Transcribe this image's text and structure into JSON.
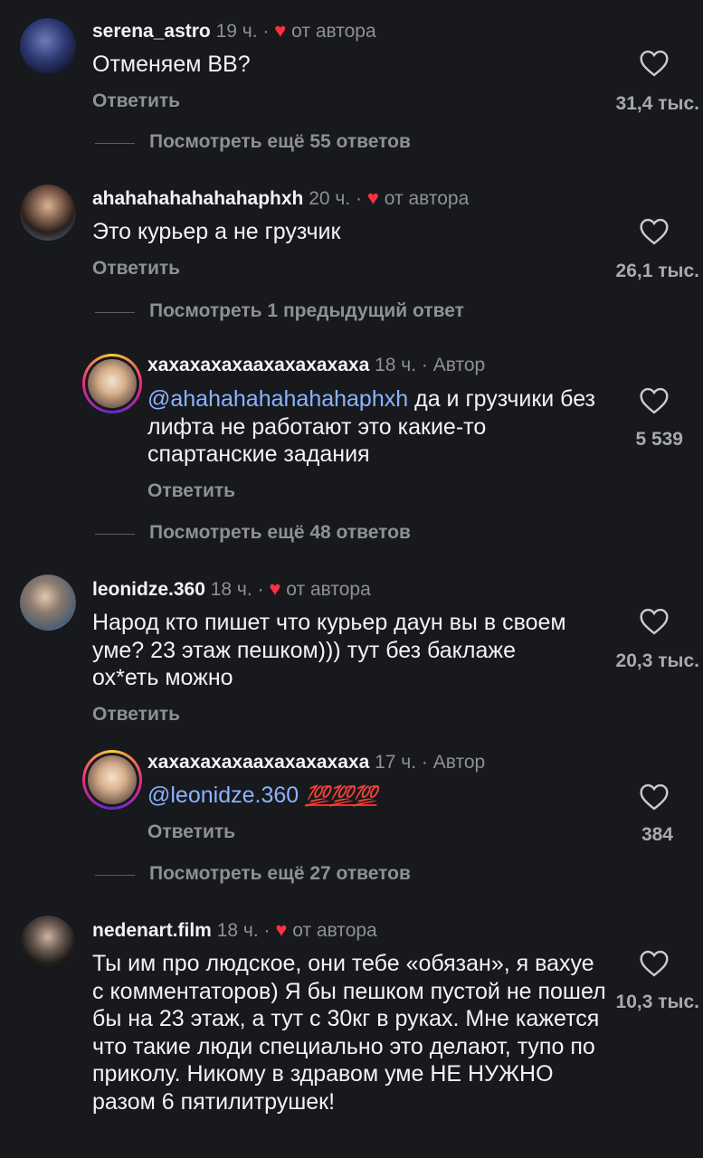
{
  "comments": [
    {
      "user": "serena_astro",
      "time": "19 ч.",
      "sep": "·",
      "badge": "от автора",
      "text": "Отменяем ВВ?",
      "reply": "Ответить",
      "likes": "31,4 тыс.",
      "more": "Посмотреть ещё 55 ответов"
    },
    {
      "user": "ahahahahahahahaphxh",
      "time": "20 ч.",
      "sep": "·",
      "badge": "от автора",
      "text": "Это курьер а не грузчик",
      "reply": "Ответить",
      "likes": "26,1 тыс.",
      "more": "Посмотреть 1 предыдущий ответ"
    },
    {
      "user": "хахахахахаахахахахаха",
      "time": "18 ч.",
      "sep": "·",
      "badge": "Автор",
      "mention": "@ahahahahahahahaphxh",
      "text": " да и грузчики без лифта не работают это какие-то спартанские задания",
      "reply": "Ответить",
      "likes": "5 539",
      "more": "Посмотреть ещё 48 ответов"
    },
    {
      "user": "leonidze.360",
      "time": "18 ч.",
      "sep": "·",
      "badge": "от автора",
      "text": "Народ кто пишет что курьер даун вы в своем уме? 23 этаж пешком))) тут без баклаже ох*еть можно",
      "reply": "Ответить",
      "likes": "20,3 тыс."
    },
    {
      "user": "хахахахахаахахахахаха",
      "time": "17 ч.",
      "sep": "·",
      "badge": "Автор",
      "mention": "@leonidze.360",
      "emoji": "💯💯💯",
      "reply": "Ответить",
      "likes": "384",
      "more": "Посмотреть ещё 27 ответов"
    },
    {
      "user": "nedenart.film",
      "time": "18 ч.",
      "sep": "·",
      "badge": "от автора",
      "text": "Ты им про людское, они тебе «обязан», я вахуе с комментаторов) Я бы пешком пустой не пошел бы на 23 этаж, а тут с 30кг в руках. Мне кажется что такие люди специально это делают, тупо по приколу. Никому в здравом уме НЕ НУЖНО разом 6 пятилитрушек!",
      "likes": "10,3 тыс."
    }
  ],
  "icons": {
    "like": "heart-outline-icon",
    "author_like": "heart-filled-icon"
  },
  "colors": {
    "background": "#18191d",
    "accent_heart": "#ff3040",
    "mention": "#8ab4ff"
  }
}
